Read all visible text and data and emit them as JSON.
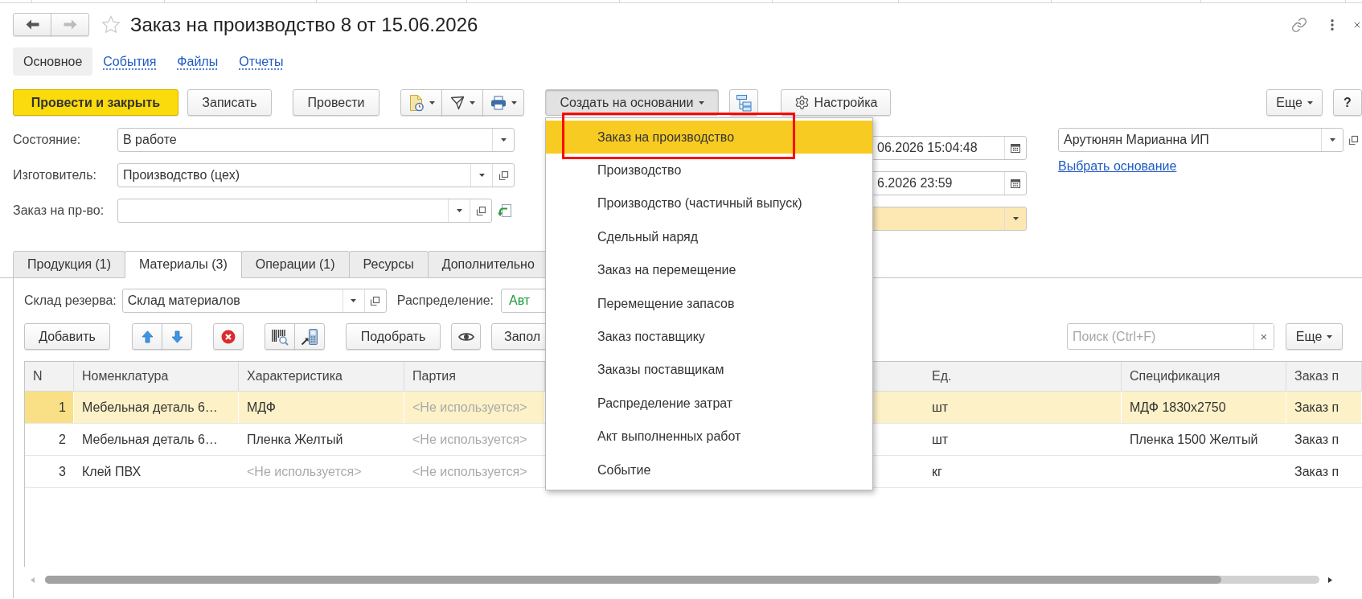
{
  "navigation": {
    "back": {
      "disabled": false
    },
    "forward": {
      "disabled": true
    }
  },
  "window": {
    "title": "Заказ на производство 8 от 15.06.2026",
    "favorite": false
  },
  "sections": [
    {
      "label": "Основное",
      "selected": true
    },
    {
      "label": "События",
      "selected": false
    },
    {
      "label": "Файлы",
      "selected": false
    },
    {
      "label": "Отчеты",
      "selected": false
    }
  ],
  "command_bar": {
    "post_and_close": "Провести и закрыть",
    "save": "Записать",
    "post": "Провести",
    "create_based_on": {
      "label": "Создать на основании",
      "expanded": true
    },
    "settings": "Настройка",
    "more": "Еще",
    "help": "?"
  },
  "header_fields": [
    {
      "label": "Состояние:",
      "value": "В работе",
      "open_button": false,
      "fill_button": false
    },
    {
      "label": "Изготовитель:",
      "value": "Производство (цех)",
      "open_button": true,
      "fill_button": false
    },
    {
      "label": "Заказ на пр-во:",
      "open_button": true,
      "fill_button": true
    }
  ],
  "period_fields": [
    {
      "kind": "date",
      "value": "06.2026 15:04:48",
      "highlighted": false
    },
    {
      "kind": "date",
      "value": "6.2026 23:59",
      "highlighted": false
    },
    {
      "kind": "choice",
      "highlighted": true
    }
  ],
  "organization": {
    "value": "Арутюнян Марианна ИП",
    "link": "Выбрать основание"
  },
  "tabs": [
    {
      "label": "Продукция (1)",
      "selected": false
    },
    {
      "label": "Материалы (3)",
      "selected": true
    },
    {
      "label": "Операции (1)",
      "selected": false
    },
    {
      "label": "Ресурсы",
      "selected": false
    },
    {
      "label": "Дополнительно",
      "selected": false
    }
  ],
  "materials": {
    "reserve_warehouse": {
      "label": "Склад резерва:",
      "value": "Склад материалов"
    },
    "distribution": {
      "label": "Распределение:",
      "value": "Авт"
    },
    "toolbar": {
      "add": "Добавить",
      "pick": "Подобрать",
      "fill": "Запол",
      "search": {
        "placeholder": "Поиск (Ctrl+F)",
        "clear": "×"
      },
      "more": "Еще"
    },
    "table": {
      "columns": [
        "N",
        "Номенклатура",
        "Характеристика",
        "Партия",
        "Ед.",
        "Спецификация",
        "Заказ п"
      ],
      "rows": [
        {
          "selected": true,
          "cells": [
            {
              "text": "1"
            },
            {
              "text": "Мебельная деталь 6…"
            },
            {
              "text": "МДФ"
            },
            {
              "placeholder": "<Не используется>"
            },
            {
              "text": "шт"
            },
            {
              "text": "МДФ 1830x2750"
            },
            {
              "text": "Заказ п"
            }
          ]
        },
        {
          "selected": false,
          "cells": [
            {
              "text": "2"
            },
            {
              "text": "Мебельная деталь 6…"
            },
            {
              "text": "Пленка Желтый"
            },
            {
              "placeholder": "<Не используется>"
            },
            {
              "text": "шт"
            },
            {
              "text": "Пленка 1500 Желтый"
            },
            {
              "text": "Заказ п"
            }
          ]
        },
        {
          "selected": false,
          "cells": [
            {
              "text": "3"
            },
            {
              "text": "Клей ПВХ"
            },
            {
              "placeholder": "<Не используется>"
            },
            {
              "placeholder": "<Не используется>"
            },
            {
              "text": "кг"
            },
            {},
            {
              "text": "Заказ п"
            }
          ]
        }
      ]
    }
  },
  "create_menu": {
    "items": [
      {
        "label": "Заказ на производство",
        "selected": true,
        "annotated": true
      },
      {
        "label": "Производство",
        "selected": false,
        "annotated": false
      },
      {
        "label": "Производство (частичный выпуск)",
        "selected": false,
        "annotated": false
      },
      {
        "label": "Сдельный наряд",
        "selected": false,
        "annotated": false
      },
      {
        "label": "Заказ на перемещение",
        "selected": false,
        "annotated": false
      },
      {
        "label": "Перемещение запасов",
        "selected": false,
        "annotated": false
      },
      {
        "label": "Заказ поставщику",
        "selected": false,
        "annotated": false
      },
      {
        "label": "Заказы поставщикам",
        "selected": false,
        "annotated": false
      },
      {
        "label": "Распределение затрат",
        "selected": false,
        "annotated": false
      },
      {
        "label": "Акт выполненных работ",
        "selected": false,
        "annotated": false
      },
      {
        "label": "Событие",
        "selected": false,
        "annotated": false
      }
    ]
  }
}
